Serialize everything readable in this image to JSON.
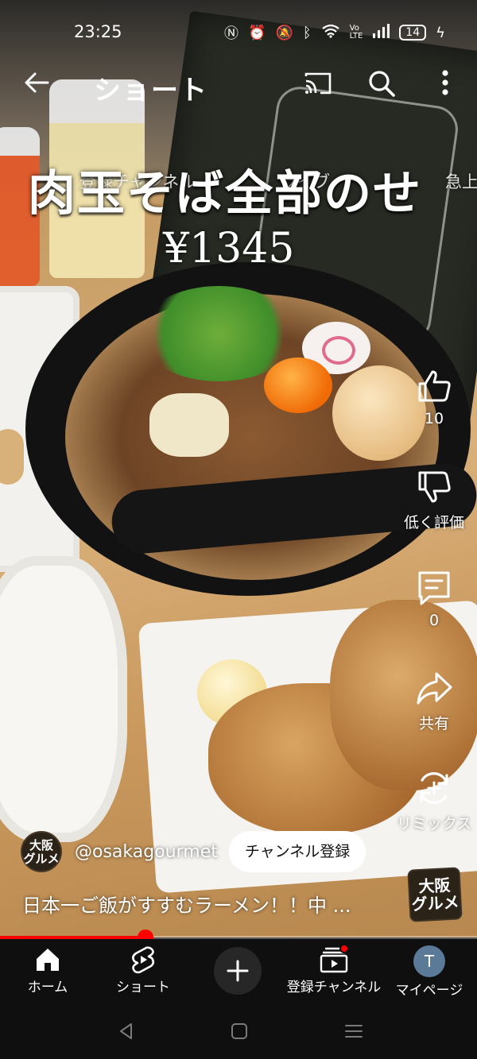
{
  "status_bar": {
    "time": "23:25",
    "battery": "14",
    "icons": [
      "nfc-icon",
      "alarm-icon",
      "mute-icon",
      "bluetooth-icon",
      "wifi-icon",
      "volte-icon",
      "signal-icon",
      "battery-icon",
      "charging-icon"
    ]
  },
  "topbar": {
    "title": "ショート",
    "icons": [
      "back-arrow-icon",
      "cast-icon",
      "search-icon",
      "more-vert-icon"
    ]
  },
  "video": {
    "overlay_title": "肉玉そば全部のせ",
    "overlay_price": "¥1345",
    "ghost_nav": [
      "登録チャンネル",
      "ライブ",
      "急上"
    ]
  },
  "actions": {
    "like_count": "10",
    "dislike_label": "低く評価",
    "comment_count": "0",
    "share_label": "共有",
    "remix_label": "リミックス"
  },
  "channel": {
    "avatar_text": "大阪\nグルメ",
    "handle": "@osakagourmet",
    "subscribe_label": "チャンネル登録"
  },
  "caption": "日本一ご飯がすすむラーメン！！中 ...",
  "sound_thumb_text": "大阪\nグルメ",
  "progress": {
    "fraction": 0.305
  },
  "bottom_nav": {
    "home": "ホーム",
    "shorts": "ショート",
    "subscriptions": "登録チャンネル",
    "mypage": "マイページ",
    "profile_initial": "T"
  },
  "colors": {
    "accent": "#ff0000",
    "nav_background": "#0f0f0f",
    "subscribe_bg": "#ffffff"
  }
}
